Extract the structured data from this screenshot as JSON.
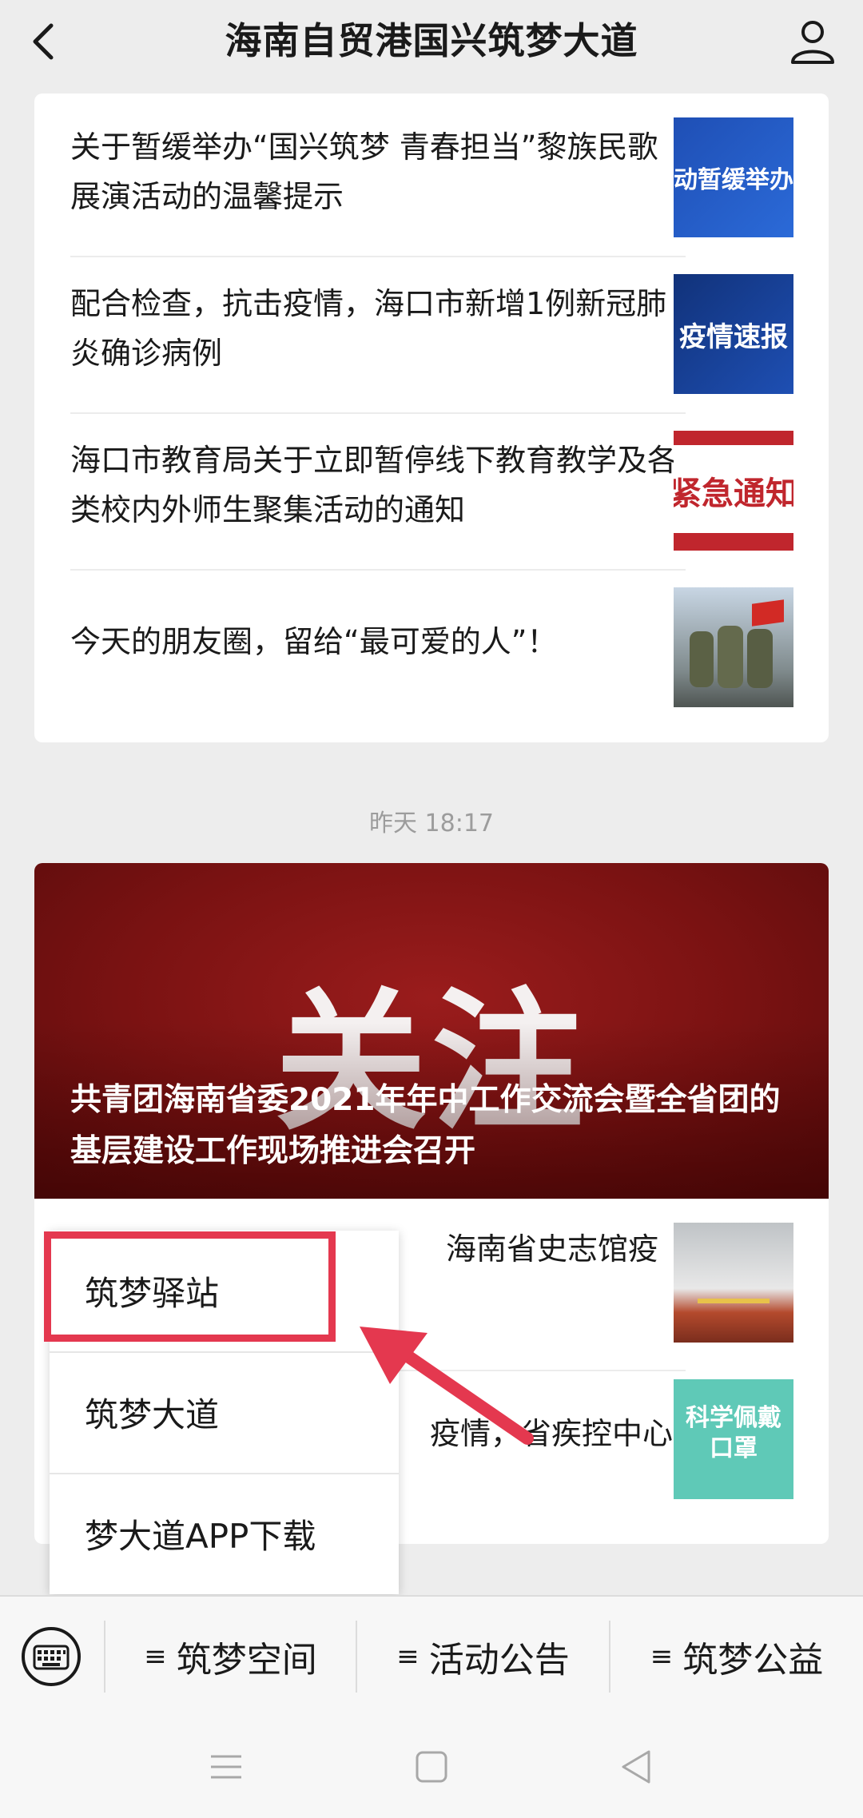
{
  "header": {
    "title": "海南自贸港国兴筑梦大道"
  },
  "articles_top": [
    {
      "title": "关于暂缓举办“国兴筑梦 青春担当”黎族民歌展演活动的温馨提示",
      "thumb_text": "动暂缓举办"
    },
    {
      "title": "配合检查，抗击疫情，海口市新增1例新冠肺炎确诊病例",
      "thumb_text": "疫情速报"
    },
    {
      "title": "海口市教育局关于立即暂停线下教育教学及各类校内外师生聚集活动的通知",
      "thumb_text": "紧急通知"
    },
    {
      "title": "今天的朋友圈，留给“最可爱的人”！",
      "thumb_text": ""
    }
  ],
  "timestamp": "昨天 18:17",
  "hero": {
    "image_word": "关注",
    "title": "共青团海南省委2021年年中工作交流会暨全省团的基层建设工作现场推进会召开"
  },
  "articles_bottom": [
    {
      "title_visible": "海南省史志馆疫"
    },
    {
      "title_visible": "疫情，省疾控中心",
      "thumb_text": "科学佩戴口罩"
    }
  ],
  "popup_menu": {
    "items": [
      "筑梦驿站",
      "筑梦大道",
      "梦大道APP下载"
    ]
  },
  "menu_bar": {
    "items": [
      "筑梦空间",
      "活动公告",
      "筑梦公益"
    ],
    "hamburger_glyph": "≡"
  },
  "colors": {
    "highlight": "#e4384f",
    "hero_red": "#7a1212",
    "background": "#ededed"
  }
}
